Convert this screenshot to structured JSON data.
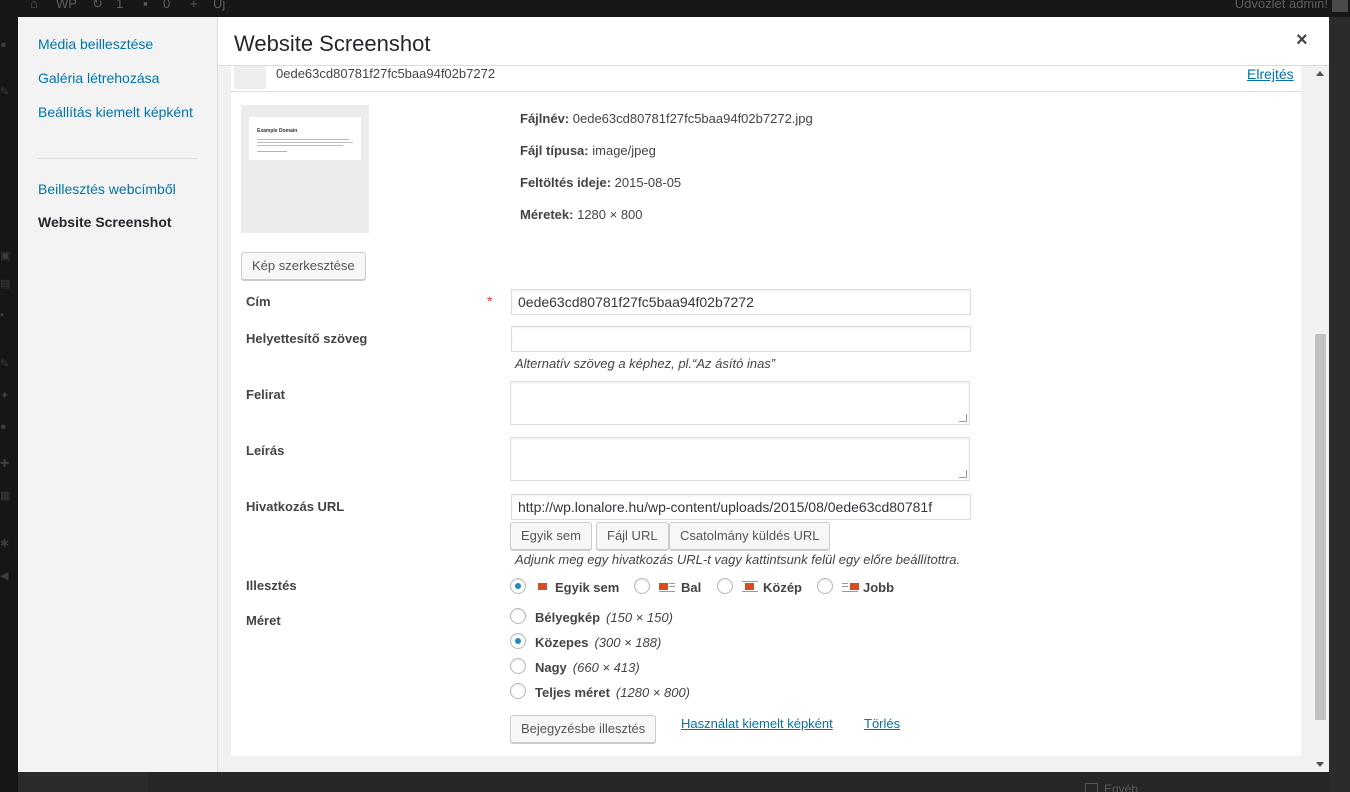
{
  "admin_bar": {
    "site": "WP",
    "updates": "1",
    "comments": "0",
    "new": "Új",
    "greeting": "Üdvözlet admin!"
  },
  "background": {
    "egyeb": "Egyéb"
  },
  "menu": {
    "items": [
      {
        "label": "Média beillesztése"
      },
      {
        "label": "Galéria létrehozása"
      },
      {
        "label": "Beállítás kiemelt képként"
      },
      {
        "label": "Beillesztés webcímből"
      }
    ],
    "active": "Website Screenshot"
  },
  "modal": {
    "title": "Website Screenshot",
    "close": "×"
  },
  "attachment": {
    "name": "0ede63cd80781f27fc5baa94f02b7272",
    "hide": "Elrejtés",
    "thumbnail_title": "Example Domain",
    "meta": [
      {
        "label": "Fájlnév:",
        "value": "0ede63cd80781f27fc5baa94f02b7272.jpg"
      },
      {
        "label": "Fájl típusa:",
        "value": "image/jpeg"
      },
      {
        "label": "Feltöltés ideje:",
        "value": "2015-08-05"
      },
      {
        "label": "Méretek:",
        "value": "1280 × 800"
      }
    ],
    "edit_button": "Kép szerkesztése"
  },
  "form": {
    "title": {
      "label": "Cím",
      "required": "*",
      "value": "0ede63cd80781f27fc5baa94f02b7272"
    },
    "alt": {
      "label": "Helyettesítő szöveg",
      "value": "",
      "help": "Alternatív szöveg a képhez, pl.“Az ásító inas”"
    },
    "caption": {
      "label": "Felirat"
    },
    "description": {
      "label": "Leírás"
    },
    "link": {
      "label": "Hivatkozás URL",
      "value": "http://wp.lonalore.hu/wp-content/uploads/2015/08/0ede63cd80781f",
      "buttons": [
        "Egyik sem",
        "Fájl URL",
        "Csatolmány küldés URL"
      ],
      "help": "Adjunk meg egy hivatkozás URL-t vagy kattintsunk felül egy előre beállítottra."
    },
    "align": {
      "label": "Illesztés",
      "options": [
        "Egyik sem",
        "Bal",
        "Közép",
        "Jobb"
      ],
      "selected": "Egyik sem"
    },
    "size": {
      "label": "Méret",
      "options": [
        {
          "name": "Bélyegkép",
          "dims": "(150 × 150)"
        },
        {
          "name": "Közepes",
          "dims": "(300 × 188)"
        },
        {
          "name": "Nagy",
          "dims": "(660 × 413)"
        },
        {
          "name": "Teljes méret",
          "dims": "(1280 × 800)"
        }
      ],
      "selected": "Közepes"
    },
    "actions": {
      "insert": "Bejegyzésbe illesztés",
      "featured": "Használat kiemelt képként",
      "delete": "Törlés"
    }
  },
  "colors": {
    "link": "#0073aa",
    "required": "#dc3232",
    "radio_checked": "#1e8cbe",
    "align_icon": "#d54e21"
  }
}
